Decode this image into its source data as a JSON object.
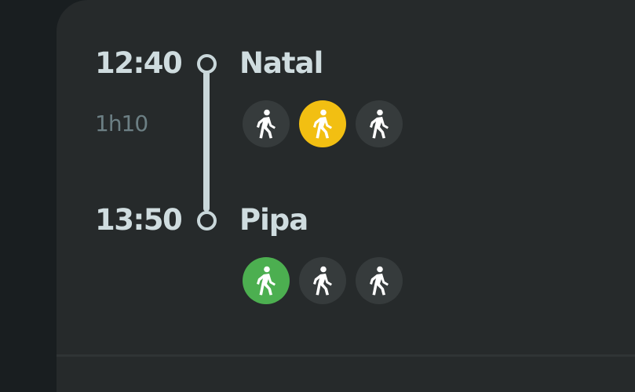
{
  "route": {
    "departure": {
      "time": "12:40",
      "place": "Natal"
    },
    "duration": "1h10",
    "arrival": {
      "time": "13:50",
      "place": "Pipa"
    }
  },
  "icon_rows": {
    "departure": [
      {
        "icon": "walking-person-icon",
        "color": "#363b3c"
      },
      {
        "icon": "walking-person-icon",
        "color": "#f2bf12"
      },
      {
        "icon": "walking-person-icon",
        "color": "#363b3c"
      }
    ],
    "arrival": [
      {
        "icon": "walking-person-icon",
        "color": "#4caf50"
      },
      {
        "icon": "walking-person-icon",
        "color": "#363b3c"
      },
      {
        "icon": "walking-person-icon",
        "color": "#363b3c"
      }
    ]
  },
  "colors": {
    "background": "#191e20",
    "card": "#262a2b",
    "text": "#cfdcdf",
    "muted_text": "#6c7f84",
    "rail": "#c9d7da"
  }
}
